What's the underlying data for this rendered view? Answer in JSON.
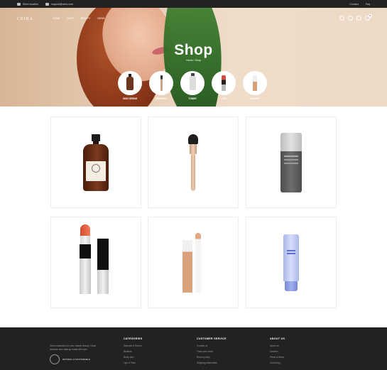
{
  "topbar": {
    "left": [
      {
        "icon": "location-icon",
        "text": "Store location"
      },
      {
        "icon": "mail-icon",
        "text": "support@ceira.com"
      }
    ],
    "right": [
      "Contact",
      "Faq"
    ]
  },
  "header": {
    "logo": "CEIRA",
    "nav": [
      "HOME",
      "SHOP",
      "BEAUTY",
      "NEWS"
    ],
    "icons": [
      "search-icon",
      "user-icon",
      "heart-icon",
      "cart-icon"
    ],
    "cart_count": "0"
  },
  "hero": {
    "title": "Shop",
    "breadcrumb": "Home  /  Shop",
    "categories": [
      {
        "label": "SKIN SERUM"
      },
      {
        "label": "BRUSHES"
      },
      {
        "label": "TONER"
      },
      {
        "label": "LIPS"
      },
      {
        "label": "MAKEUP"
      }
    ]
  },
  "products": [
    {
      "name": "serum-bottle"
    },
    {
      "name": "makeup-brush"
    },
    {
      "name": "sunscreen-tube"
    },
    {
      "name": "lipstick"
    },
    {
      "name": "concealer"
    },
    {
      "name": "face-cream-tube"
    }
  ],
  "footer": {
    "about": "Ceira cosmetics for your natural beauty. Clean skincare and makeup made with care.",
    "seal_text": "NATURAL & SUSTAINABLE",
    "columns": [
      {
        "title": "CATEGORIES",
        "links": [
          "Skincare & Serum",
          "Brushes",
          "Body care",
          "Lips & Face"
        ]
      },
      {
        "title": "CUSTOMER SERVICE",
        "links": [
          "Contact us",
          "Track your order",
          "Return policy",
          "Shipping information"
        ]
      },
      {
        "title": "ABOUT US",
        "links": [
          "About us",
          "Careers",
          "Press & News",
          "Ceira blog"
        ]
      }
    ]
  },
  "colors": {
    "topbar": "#222222",
    "footer": "#222222",
    "hero_bg": "#e8cfb7",
    "leaf": "#2f6b25"
  }
}
